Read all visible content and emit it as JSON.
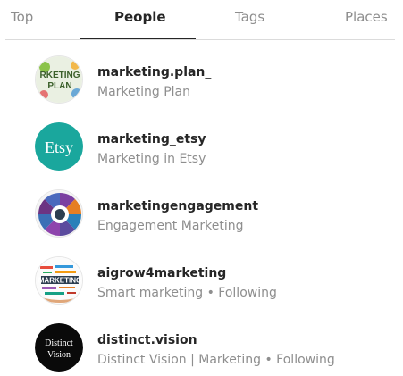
{
  "tabs": [
    {
      "label": "Top"
    },
    {
      "label": "People"
    },
    {
      "label": "Tags"
    },
    {
      "label": "Places"
    }
  ],
  "active_tab": "People",
  "results": [
    {
      "username": "marketing.plan_",
      "subtitle": "Marketing Plan",
      "avatar": "marketing-plan-avatar"
    },
    {
      "username": "marketing_etsy",
      "subtitle": "Marketing in Etsy",
      "avatar": "etsy-logo-avatar",
      "avatar_text": "Etsy",
      "avatar_color": "#1aa79d"
    },
    {
      "username": "marketingengagement",
      "subtitle": "Engagement Marketing",
      "avatar": "engagement-wheel-avatar"
    },
    {
      "username": "aigrow4marketing",
      "subtitle": "Smart marketing • Following",
      "avatar": "marketing-wordcloud-avatar"
    },
    {
      "username": "distinct.vision",
      "subtitle": "Distinct Vision | Marketing • Following",
      "avatar": "distinct-vision-logo-avatar",
      "avatar_text_1": "Distinct",
      "avatar_text_2": "Vision"
    }
  ],
  "colors": {
    "text_primary": "#262626",
    "text_secondary": "#8e8e8e",
    "divider": "#dbdbdb",
    "etsy_teal": "#1aa79d"
  }
}
